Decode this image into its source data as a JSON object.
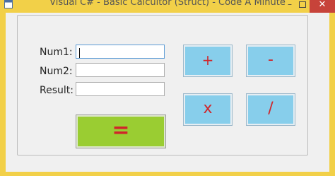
{
  "window": {
    "title": "Visual C# - Basic Calcultor (Struct) - Code A Minute",
    "frame_color": "#f2d048",
    "icon": "app-window-icon",
    "controls": {
      "minimize": "–",
      "close": "✕"
    }
  },
  "form": {
    "num1_label": "Num1:",
    "num2_label": "Num2:",
    "result_label": "Result:",
    "num1_value": "",
    "num2_value": "",
    "result_value": ""
  },
  "buttons": {
    "add": "+",
    "subtract": "-",
    "multiply": "x",
    "divide": "/",
    "equals": "="
  },
  "colors": {
    "operator_bg": "#87ceeb",
    "equals_bg": "#9acd32",
    "symbol": "#d0252a"
  }
}
